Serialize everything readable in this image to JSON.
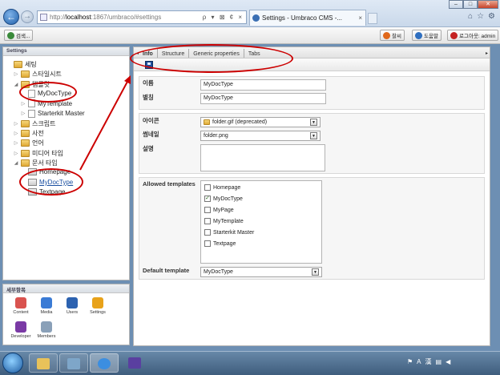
{
  "browser": {
    "url_scheme": "http://",
    "url_host": "localhost",
    "url_rest": ":1867/umbraco/#settings",
    "address_tools": "ρ ▾ ⊠ ¢ ×",
    "tab_title": "Settings - Umbraco CMS -...",
    "tab_close": "×",
    "back": "←",
    "forward": "→",
    "minimize": "–",
    "maximize": "□",
    "close": "✕"
  },
  "topbar": {
    "search_label": "검색...",
    "help_label": "찰씨",
    "help2_label": "도움말",
    "logout_label": "로그아웃: admin",
    "colors": {
      "help": "#e0681b",
      "help2": "#2f6fc0",
      "logout": "#c42222"
    }
  },
  "left": {
    "header": "Settings",
    "tree": [
      {
        "label": "세팅",
        "type": "folder",
        "level": 0,
        "expand": ""
      },
      {
        "label": "스타일시트",
        "type": "folder",
        "level": 1,
        "expand": "▷"
      },
      {
        "label": "템플릿",
        "type": "folder",
        "level": 1,
        "expand": "◢"
      },
      {
        "label": "MyDocType",
        "type": "doc",
        "level": 2,
        "expand": ""
      },
      {
        "label": "MyTemplate",
        "type": "doc",
        "level": 2,
        "expand": "▷"
      },
      {
        "label": "Starterkit Master",
        "type": "doc",
        "level": 2,
        "expand": "▷"
      },
      {
        "label": "스크립트",
        "type": "folder",
        "level": 1,
        "expand": "▷"
      },
      {
        "label": "사전",
        "type": "folder",
        "level": 1,
        "expand": "▷"
      },
      {
        "label": "언어",
        "type": "folder",
        "level": 1,
        "expand": "▷"
      },
      {
        "label": "미디어 타입",
        "type": "folder",
        "level": 1,
        "expand": "▷"
      },
      {
        "label": "문서 타입",
        "type": "folder",
        "level": 1,
        "expand": "◢"
      },
      {
        "label": "Homepage",
        "type": "tmpl",
        "level": 2,
        "expand": ""
      },
      {
        "label": "MyDocType",
        "type": "tmpl",
        "level": 2,
        "expand": "",
        "linked": true
      },
      {
        "label": "Textpage",
        "type": "tmpl",
        "level": 2,
        "expand": ""
      }
    ]
  },
  "sections": {
    "header": "세부항목",
    "items": [
      {
        "label": "Content",
        "color": "#d9534f"
      },
      {
        "label": "Media",
        "color": "#3a7bd5"
      },
      {
        "label": "Users",
        "color": "#2c62b0"
      },
      {
        "label": "Settings",
        "color": "#e8a21a"
      },
      {
        "label": "Developer",
        "color": "#7a3aa5"
      },
      {
        "label": "Members",
        "color": "#8aa0b8"
      }
    ]
  },
  "main": {
    "tabs": [
      "Info",
      "Structure",
      "Generic properties",
      "Tabs"
    ],
    "name_label": "이름",
    "name_value": "MyDocType",
    "alias_label": "별칭",
    "alias_value": "MyDocType",
    "icon_label": "아이콘",
    "icon_value": "folder.gif (deprecated)",
    "thumb_label": "썸네일",
    "thumb_value": "folder.png",
    "desc_label": "설명",
    "desc_value": "",
    "allowed_label": "Allowed templates",
    "templates": [
      {
        "name": "Homepage",
        "checked": false
      },
      {
        "name": "MyDocType",
        "checked": true
      },
      {
        "name": "MyPage",
        "checked": false
      },
      {
        "name": "MyTemplate",
        "checked": false
      },
      {
        "name": "Starterkit Master",
        "checked": false
      },
      {
        "name": "Textpage",
        "checked": false
      }
    ],
    "default_label": "Default template",
    "default_value": "MyDocType"
  },
  "taskbar": {
    "tray_lang": "A",
    "tray_kor": "漢"
  }
}
